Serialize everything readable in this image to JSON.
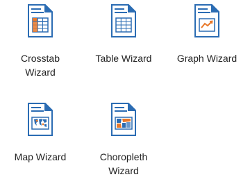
{
  "wizards": [
    {
      "label": "Crosstab\nWizard",
      "icon": "crosstab-document-icon"
    },
    {
      "label": "Table Wizard",
      "icon": "table-document-icon"
    },
    {
      "label": "Graph Wizard",
      "icon": "graph-document-icon"
    },
    {
      "label": "Map Wizard",
      "icon": "map-document-icon"
    },
    {
      "label": "Choropleth\nWizard",
      "icon": "choropleth-document-icon"
    }
  ],
  "colors": {
    "doc_border": "#2b6cb3",
    "doc_fold": "#2b6cb3",
    "doc_lines": "#2b6cb3",
    "accent_orange": "#e8782a",
    "map_blue": "#2b6cb3",
    "map_orange": "#e8782a"
  }
}
